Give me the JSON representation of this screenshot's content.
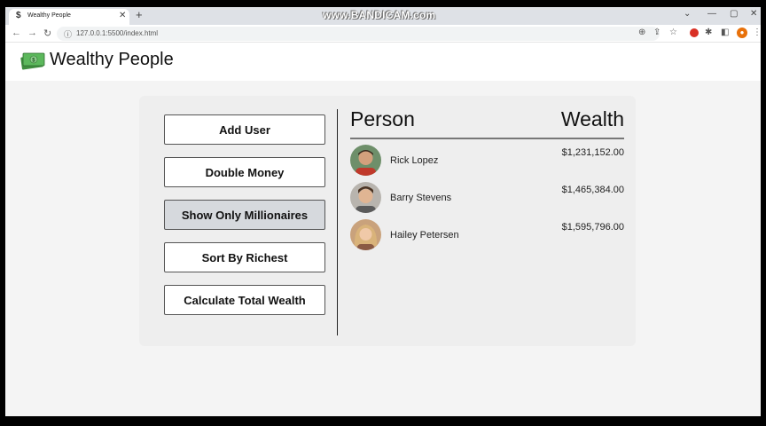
{
  "browser": {
    "tab_title": "Wealthy People",
    "tab_favicon": "$",
    "watermark": "www.BANDICAM.com",
    "url": "127.0.0.1:5500/index.html"
  },
  "header": {
    "title": "Wealthy People",
    "logo_icon": "money-icon"
  },
  "buttons": {
    "add_user": "Add User",
    "double_money": "Double Money",
    "show_millionaires": "Show Only Millionaires",
    "sort_richest": "Sort By Richest",
    "calc_total": "Calculate Total Wealth"
  },
  "table": {
    "person_header": "Person",
    "wealth_header": "Wealth",
    "rows": [
      {
        "name": "Rick Lopez",
        "wealth": "$1,231,152.00"
      },
      {
        "name": "Barry Stevens",
        "wealth": "$1,465,384.00"
      },
      {
        "name": "Hailey Petersen",
        "wealth": "$1,595,796.00"
      }
    ]
  },
  "colors": {
    "accent": "#4caf50",
    "card_bg": "#eeeeee",
    "active_button": "#d6d9dd"
  }
}
